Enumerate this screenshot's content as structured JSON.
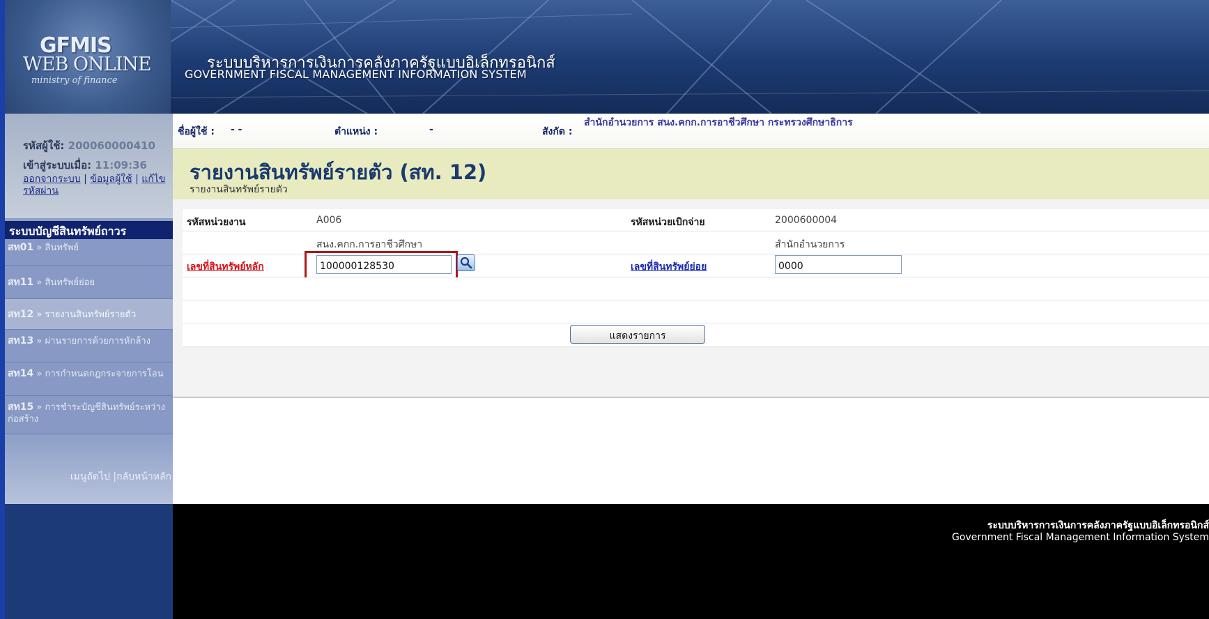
{
  "header": {
    "logo_gfmis": "GFMIS",
    "logo_web_online": "WEB ONLINE",
    "logo_ministry": "ministry of finance",
    "title_th": "ระบบบริหารการเงินการคลังภาครัฐแบบอิเล็กทรอนิกส์",
    "title_en": "GOVERNMENT FISCAL MANAGEMENT INFORMATION SYSTEM"
  },
  "user_panel": {
    "user_id_label": "รหัสผู้ใช้:",
    "user_id_value": "200060000410",
    "login_label": "เข้าสู่ระบบเมื่อ:",
    "login_time": "11:09:36",
    "link_logout": "ออกจากระบบ",
    "link_user_info": "ข้อมูลผู้ใช้",
    "link_change_password": "แก้ไขรหัสผ่าน",
    "separator": "|"
  },
  "sidebar": {
    "menu_title": "ระบบบัญชีสินทรัพย์ถาวร",
    "items": [
      {
        "code": "สท01",
        "label": "สินทรัพย์"
      },
      {
        "code": "สท11",
        "label": "สินทรัพย์ย่อย"
      },
      {
        "code": "สท12",
        "label": "รายงานสินทรัพย์รายตัว"
      },
      {
        "code": "สท13",
        "label": "ผ่านรายการด้วยการหักล้าง"
      },
      {
        "code": "สท14",
        "label": "การกำหนดกฎกระจายการโอน"
      },
      {
        "code": "สท15",
        "label": "การชำระบัญชีสินทรัพย์ระหว่างก่อสร้าง"
      }
    ],
    "arrow": "»",
    "footer_links": "เมนูถัดไป |กลับหน้าหลัก"
  },
  "info_bar": {
    "user_label": "ชื่อผู้ใช้ :",
    "user_value": "- -",
    "position_label": "ตำแหน่ง :",
    "position_value": "-",
    "org_label": "สังกัด :",
    "org_value": "สำนักอำนวยการ สนง.คกก.การอาชีวศึกษา กระทรวงศึกษาธิการ"
  },
  "page": {
    "title": "รายงานสินทรัพย์รายตัว (สท. 12)",
    "subtitle": "รายงานสินทรัพย์รายตัว"
  },
  "form": {
    "agency_code_label": "รหัสหน่วยงาน",
    "agency_code_value": "A006",
    "agency_name": "สนง.คกก.การอาชีวศึกษา",
    "disbursing_unit_label": "รหัสหน่วยเบิกจ่าย",
    "disbursing_unit_value": "2000600004",
    "disbursing_unit_name": "สำนักอำนวยการ",
    "main_asset_label": "เลขที่สินทรัพย์หลัก",
    "main_asset_value": "100000128530",
    "sub_asset_label": "เลขที่สินทรัพย์ย่อย",
    "sub_asset_value": "0000",
    "show_button": "แสดงรายการ"
  },
  "footer": {
    "text_th": "ระบบบริหารการเงินการคลังภาครัฐแบบอิเล็กทรอนิกส์",
    "text_en": "Government Fiscal Management Information System"
  },
  "colors": {
    "header_navy": "#1d3b73",
    "menu_title_bg": "#10236e",
    "title_band": "#e8ebc0",
    "highlight_red": "#b01818",
    "link_red": "#d6121b",
    "link_blue": "#1a2bb0"
  },
  "icons": {
    "search": "search-icon"
  }
}
